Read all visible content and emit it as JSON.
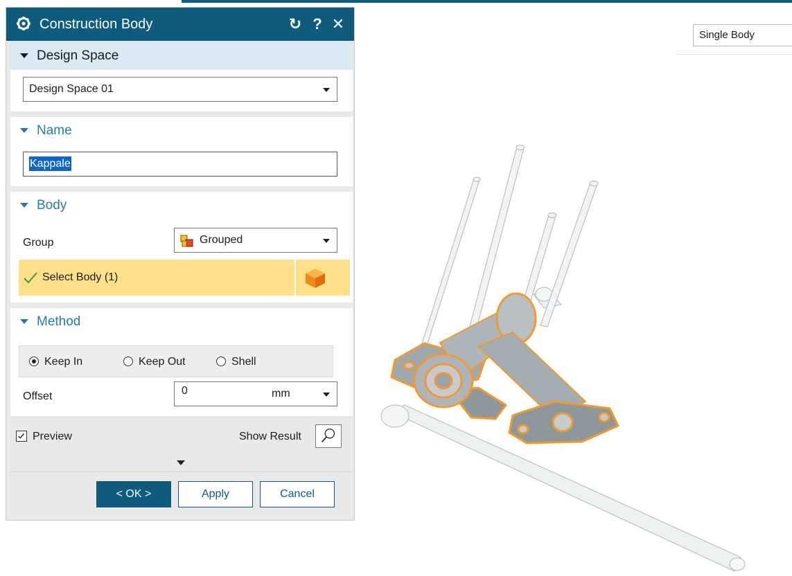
{
  "dialog": {
    "title": "Construction Body",
    "icons": {
      "settings": "gear-icon",
      "reset": "reset-icon",
      "help": "help-icon",
      "close": "close-icon"
    },
    "help_label": "?",
    "close_label": "✕",
    "reset_label": "↻"
  },
  "design_space": {
    "header": "Design Space",
    "value": "Design Space 01"
  },
  "name": {
    "header": "Name",
    "value": "Kappale"
  },
  "body": {
    "header": "Body",
    "group_label": "Group",
    "group_value": "Grouped",
    "select_label": "Select Body (1)"
  },
  "method": {
    "header": "Method",
    "options": [
      "Keep In",
      "Keep Out",
      "Shell"
    ],
    "selected": "Keep In",
    "offset_label": "Offset",
    "offset_value": "0",
    "offset_unit": "mm"
  },
  "footer": {
    "preview_label": "Preview",
    "preview_checked": true,
    "show_result_label": "Show Result",
    "ok_label": "< OK >",
    "apply_label": "Apply",
    "cancel_label": "Cancel"
  },
  "toolbar": {
    "body_mode": "Single Body"
  },
  "colors": {
    "title_bar": "#0f5b7d",
    "section_header_bg": "#dbe9f2",
    "selection_bar": "#ffe08a",
    "highlight_orange": "#f39a2b",
    "part_gray": "#a9b1b6"
  }
}
